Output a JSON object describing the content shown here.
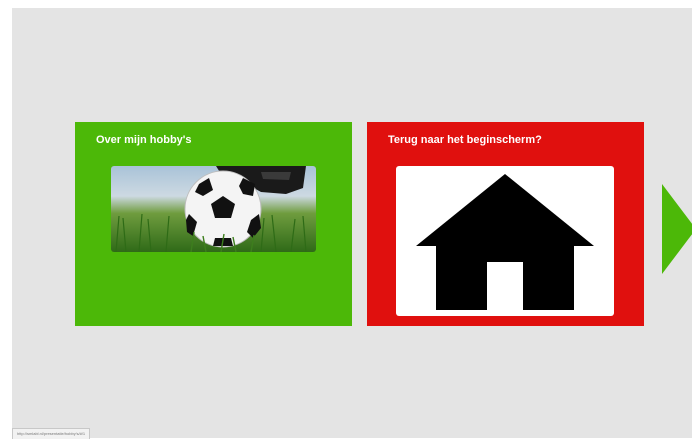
{
  "cards": [
    {
      "title": "Over mijn hobby's",
      "image": "soccer-ball-photo",
      "color": "#4cb808"
    },
    {
      "title": "Terug naar het beginscherm?",
      "image": "home-icon",
      "color": "#e0100e"
    }
  ],
  "navigation": {
    "next_icon": "right-arrow-icon",
    "next_color": "#4cb808"
  },
  "colors": {
    "background": "#e4e4e4"
  },
  "status_bar": {
    "url": "http://smlabl.nl/presentatie/hobby's/#/1"
  }
}
